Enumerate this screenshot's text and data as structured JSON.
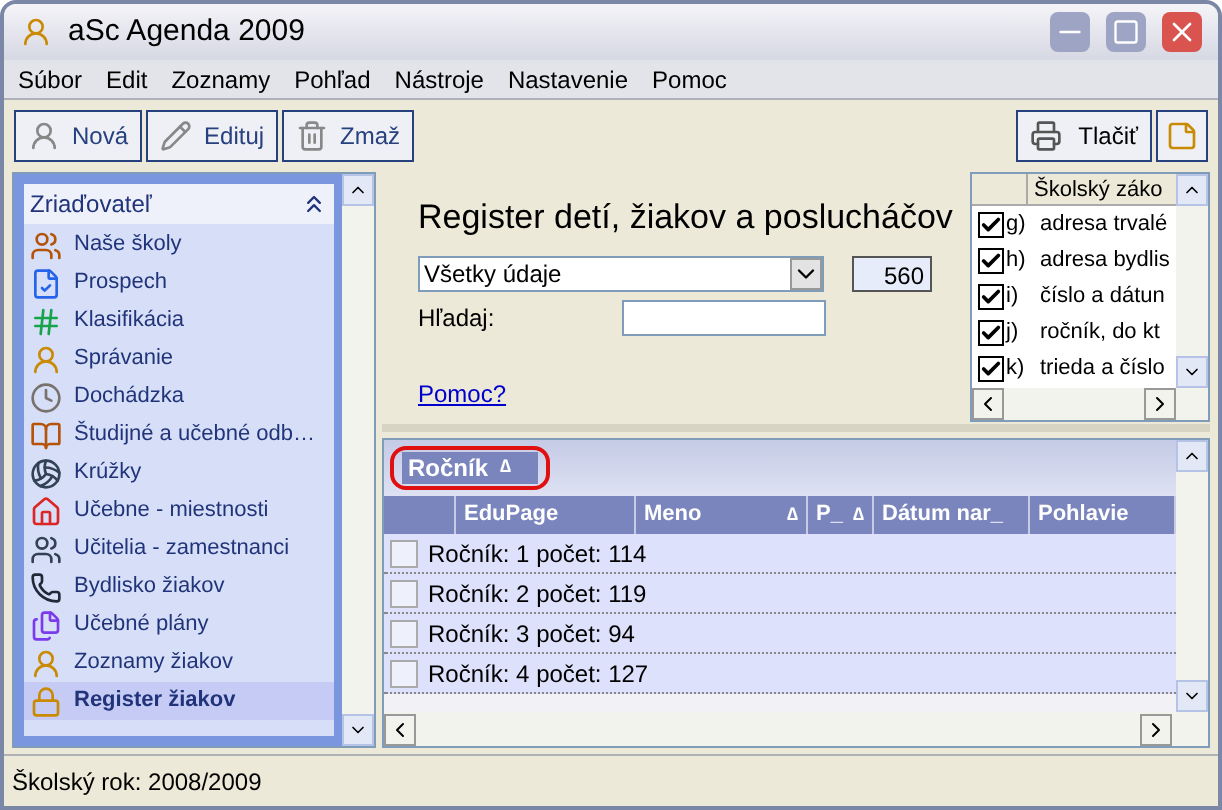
{
  "window": {
    "title": "aSc Agenda 2009"
  },
  "menu": [
    "Súbor",
    "Edit",
    "Zoznamy",
    "Pohľad",
    "Nástroje",
    "Nastavenie",
    "Pomoc"
  ],
  "toolbar": {
    "left": [
      "Nová",
      "Edituj",
      "Zmaž"
    ],
    "right": [
      "Tlačiť"
    ]
  },
  "sidebar": {
    "header": "Zriaďovateľ",
    "items": [
      {
        "label": "Naše školy",
        "selected": false
      },
      {
        "label": "Prospech",
        "selected": false
      },
      {
        "label": "Klasifikácia",
        "selected": false
      },
      {
        "label": "Správanie",
        "selected": false
      },
      {
        "label": "Dochádzka",
        "selected": false
      },
      {
        "label": "Študijné a  učebné odb…",
        "selected": false
      },
      {
        "label": "Krúžky",
        "selected": false
      },
      {
        "label": "Učebne - miestnosti",
        "selected": false
      },
      {
        "label": "Učitelia - zamestnanci",
        "selected": false
      },
      {
        "label": "Bydlisko žiakov",
        "selected": false
      },
      {
        "label": "Učebné plány",
        "selected": false
      },
      {
        "label": "Zoznamy žiakov",
        "selected": false
      },
      {
        "label": "Register žiakov",
        "selected": true
      }
    ]
  },
  "register": {
    "title": "Register detí, žiakov a poslucháčov",
    "filter": "Všetky údaje",
    "count": "560",
    "search_label": "Hľadaj:",
    "help_link": "Pomoc?"
  },
  "fields": {
    "header": "Školský záko",
    "items": [
      {
        "code": "g)",
        "label": "adresa trvalé",
        "checked": true
      },
      {
        "code": "h)",
        "label": "adresa bydlis",
        "checked": true
      },
      {
        "code": "i)",
        "label": "číslo a dátun",
        "checked": true
      },
      {
        "code": "j)",
        "label": "ročník, do kt",
        "checked": true
      },
      {
        "code": "k)",
        "label": "trieda a číslo",
        "checked": true
      }
    ]
  },
  "grid": {
    "group_by": "Ročník",
    "group_sort": "∆",
    "columns": [
      {
        "label": "EduPage"
      },
      {
        "label": "Meno",
        "sort": "∆"
      },
      {
        "label": "P_",
        "sort": "∆"
      },
      {
        "label": "Dátum nar_"
      },
      {
        "label": "Pohlavie"
      }
    ],
    "rows": [
      {
        "group": "Ročník:",
        "value": "1",
        "count": "počet: 114"
      },
      {
        "group": "Ročník:",
        "value": "2",
        "count": "počet: 119"
      },
      {
        "group": "Ročník:",
        "value": "3",
        "count": "počet: 94"
      },
      {
        "group": "Ročník:",
        "value": "4",
        "count": "počet: 127"
      }
    ]
  },
  "status_bar": "Školský rok: 2008/2009"
}
